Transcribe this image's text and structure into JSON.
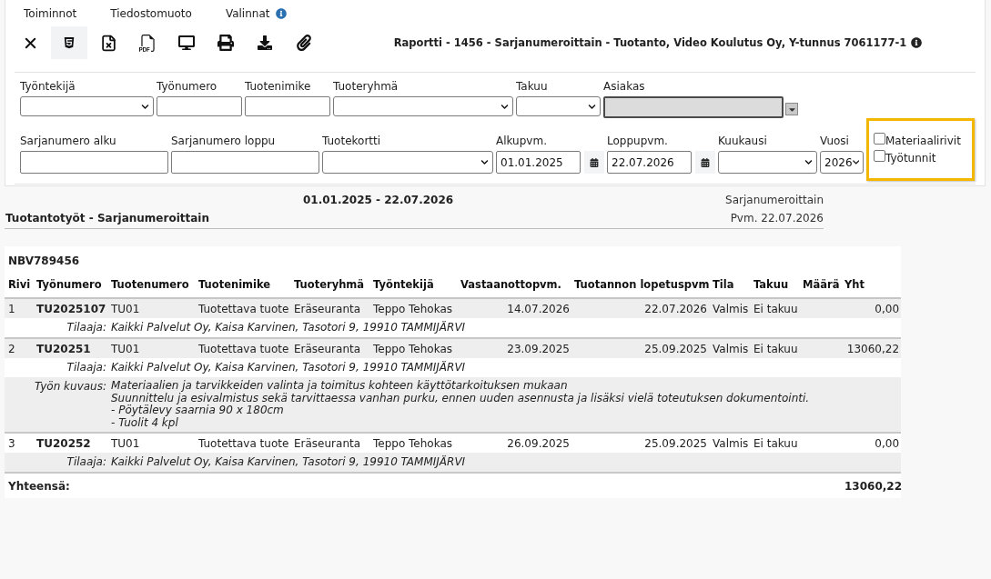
{
  "menu": [
    {
      "label": "Toiminnot",
      "info": false
    },
    {
      "label": "Tiedostomuoto",
      "info": false
    },
    {
      "label": "Valinnat",
      "info": true
    }
  ],
  "toolbar": [
    {
      "kind": "close",
      "selected": false
    },
    {
      "kind": "html",
      "selected": true
    },
    {
      "kind": "excel",
      "selected": false
    },
    {
      "kind": "pdf",
      "selected": false
    },
    {
      "kind": "screen",
      "selected": false
    },
    {
      "kind": "print",
      "selected": false
    },
    {
      "kind": "download",
      "selected": false
    },
    {
      "kind": "attach",
      "selected": false
    }
  ],
  "report_title": "Raportti - 1456 - Sarjanumeroittain - Tuotanto, Video Koulutus Oy, Y-tunnus 7061177-1",
  "filters": {
    "row_1": [
      {
        "label": "Työntekijä",
        "kind": "select",
        "disabled": false
      },
      {
        "label": "Työnumero",
        "kind": "text",
        "disabled": false
      },
      {
        "label": "Tuotenimike",
        "kind": "text",
        "disabled": false
      },
      {
        "label": "Tuoteryhmä",
        "kind": "select",
        "disabled": false
      },
      {
        "label": "Takuu",
        "kind": "select",
        "disabled": false
      },
      {
        "label": "Asiakas",
        "kind": "combo",
        "disabled": true
      }
    ],
    "row_2": [
      {
        "label": "Sarjanumero alku",
        "kind": "text",
        "disabled": false
      },
      {
        "label": "Sarjanumero loppu",
        "kind": "text",
        "disabled": false
      },
      {
        "label": "Tuotekortti",
        "kind": "select",
        "disabled": false
      },
      {
        "label": "Alkupvm.",
        "kind": "date",
        "value": "01.01.2025",
        "disabled": false
      },
      {
        "label": "Loppupvm.",
        "kind": "date",
        "value": "22.07.2026",
        "disabled": false
      },
      {
        "label": "Kuukausi",
        "kind": "select",
        "disabled": false
      },
      {
        "label": "Vuosi",
        "kind": "select",
        "value": "2026",
        "disabled": false
      }
    ]
  },
  "options": {
    "highlighted": true,
    "items": [
      {
        "label": "Materiaalirivit",
        "checked": false
      },
      {
        "label": "Työtunnit",
        "checked": false
      }
    ]
  },
  "report": {
    "period": "01.01.2025 - 22.07.2026",
    "title": "Tuotantotyöt - Sarjanumeroittain",
    "type": "Sarjanumeroittain",
    "date": "Pvm. 22.07.2026"
  },
  "table": {
    "group": "NBV789456",
    "columns": [
      "Rivi",
      "Työnumero",
      "Tuotenumero",
      "Tuotenimike",
      "Tuoteryhmä",
      "Työntekijä",
      "Vastaanottopvm.",
      "Tuotannon lopetuspvm",
      "Tila",
      "Takuu",
      "Määrä",
      "Yht"
    ],
    "rows": [
      {
        "cells": [
          "1",
          "TU2025107",
          "TU01",
          "Tuotettava tuote",
          "Eräseuranta",
          "Teppo Tehokas",
          "14.07.2026",
          "22.07.2026",
          "Valmis",
          "Ei takuu",
          null,
          "0,00"
        ],
        "details": [
          {
            "label": "Tilaaja:",
            "lines": [
              "Kaikki Palvelut Oy, Kaisa Karvinen, Tasotori 9, 19910 TAMMIJÄRVI"
            ]
          }
        ]
      },
      {
        "cells": [
          "2",
          "TU20251",
          "TU01",
          "Tuotettava tuote",
          "Eräseuranta",
          "Teppo Tehokas",
          "23.09.2025",
          "25.09.2025",
          "Valmis",
          "Ei takuu",
          null,
          "13060,22"
        ],
        "details": [
          {
            "label": "Tilaaja:",
            "lines": [
              "Kaikki Palvelut Oy, Kaisa Karvinen, Tasotori 9, 19910 TAMMIJÄRVI"
            ]
          },
          {
            "label": "Työn kuvaus:",
            "lines": [
              "Materiaalien ja tarvikkeiden valinta ja toimitus kohteen käyttötarkoituksen mukaan",
              "Suunnittelu ja esivalmistus sekä tarvittaessa vanhan purku, ennen uuden asennusta ja lisäksi vielä toteutuksen dokumentointi.",
              "- Pöytälevy saarnia 90 x 180cm",
              "- Tuolit 4 kpl"
            ]
          }
        ]
      },
      {
        "cells": [
          "3",
          "TU20252",
          "TU01",
          "Tuotettava tuote",
          "Eräseuranta",
          "Teppo Tehokas",
          "26.09.2025",
          "25.09.2025",
          "Valmis",
          "Ei takuu",
          null,
          "0,00"
        ],
        "details": [
          {
            "label": "Tilaaja:",
            "lines": [
              "Kaikki Palvelut Oy, Kaisa Karvinen, Tasotori 9, 19910 TAMMIJÄRVI"
            ]
          }
        ]
      }
    ],
    "total": {
      "label": "Yhteensä:",
      "value": "13060,22"
    }
  }
}
